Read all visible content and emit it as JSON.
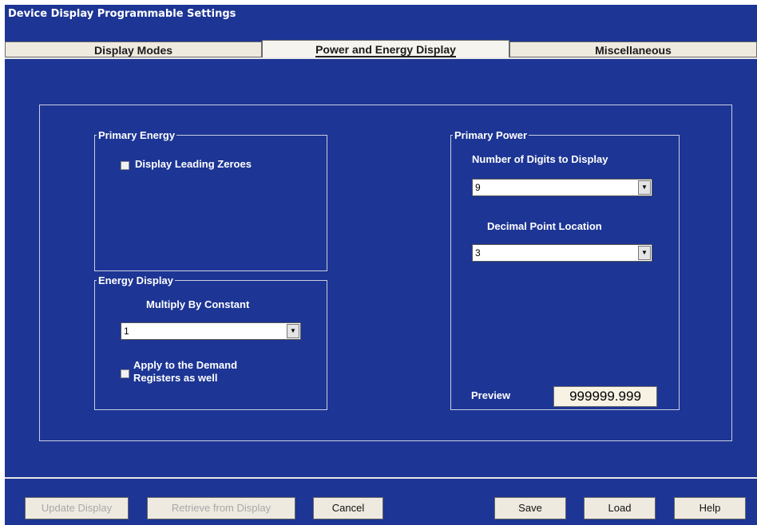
{
  "window": {
    "title": "Device Display Programmable Settings"
  },
  "tabs": [
    {
      "label": "Display Modes",
      "active": false
    },
    {
      "label": "Power and Energy Display",
      "active": true
    },
    {
      "label": "Miscellaneous",
      "active": false
    }
  ],
  "primary_energy": {
    "legend": "Primary Energy",
    "display_leading_zeroes": {
      "label": "Display Leading Zeroes",
      "checked": false
    }
  },
  "energy_display": {
    "legend": "Energy Display",
    "multiply_label": "Multiply By Constant",
    "multiply_value": "1",
    "apply_demand": {
      "label_line1": "Apply to  the Demand",
      "label_line2": "Registers as well",
      "checked": false
    }
  },
  "primary_power": {
    "legend": "Primary Power",
    "digits_label": "Number of Digits to Display",
    "digits_value": "9",
    "decimal_label": "Decimal Point Location",
    "decimal_value": "3",
    "preview_label": "Preview",
    "preview_value": "999999.999"
  },
  "buttons": {
    "update_display": "Update Display",
    "retrieve_from_display": "Retrieve from Display",
    "cancel": "Cancel",
    "save": "Save",
    "load": "Load",
    "help": "Help"
  },
  "colors": {
    "window_bg": "#1d3594",
    "tab_bg": "#efeae0",
    "text_light": "#ffffff"
  }
}
